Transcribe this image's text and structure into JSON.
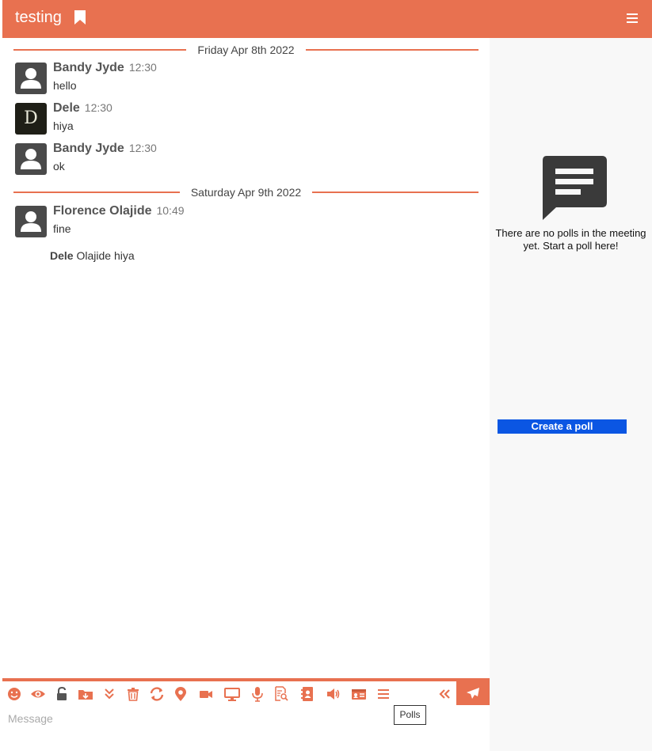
{
  "header": {
    "title": "testing",
    "accent_color": "#e87150",
    "bookmark_icon": "bookmark-icon",
    "menu_icon": "hamburger-menu-icon"
  },
  "chat": {
    "groups": [
      {
        "date": "Friday Apr 8th 2022",
        "messages": [
          {
            "author": "Bandy Jyde",
            "time": "12:30",
            "text": "hello",
            "avatar": "user-silhouette"
          },
          {
            "author": "Dele",
            "time": "12:30",
            "text": "hiya",
            "avatar": "D"
          },
          {
            "author": "Bandy Jyde",
            "time": "12:30",
            "text": "ok",
            "avatar": "user-silhouette"
          }
        ]
      },
      {
        "date": "Saturday Apr 9th 2022",
        "messages": [
          {
            "author": "Florence Olajide",
            "time": "10:49",
            "text": "fine",
            "avatar": "user-silhouette"
          }
        ]
      }
    ],
    "reply_preview": {
      "author": "Dele",
      "text": "Olajide hiya"
    }
  },
  "polls": {
    "empty_message": "There are no polls in the meeting yet. Start a poll here!",
    "create_button": "Create a poll",
    "button_color": "#0b56e3"
  },
  "composer": {
    "placeholder": "Message",
    "tooltip": "Polls",
    "toolbar_icons": [
      "emoji-icon",
      "eye-icon",
      "unlock-icon",
      "folder-download-icon",
      "double-chevron-down-icon",
      "trash-icon",
      "refresh-icon",
      "location-pin-icon",
      "video-camera-icon",
      "desktop-monitor-icon",
      "microphone-icon",
      "document-search-icon",
      "address-book-icon",
      "volume-icon",
      "id-card-icon",
      "list-icon",
      "double-chevron-left-icon"
    ],
    "send_icon": "paper-plane-icon"
  }
}
